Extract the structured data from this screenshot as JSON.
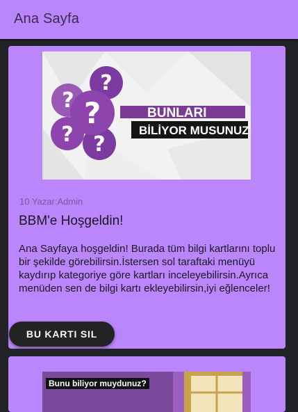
{
  "appbar": {
    "title": "Ana Sayfa"
  },
  "card1": {
    "image": {
      "line1": "BUNLARI",
      "line2": "BİLİYOR MUSUNUZ?",
      "icon": "question-marks-icon"
    },
    "meta": "10 Yazar:Admin",
    "title": "BBM'e Hoşgeldin!",
    "body": "Ana Sayfaya hoşgeldin! Burada tüm bilgi kartlarını toplu bir şekilde görebilirsin.İstersen sol taraftaki menüyü kaydırıp kategoriye göre kartları inceleyebilirsin.Ayrıca menüden sen de bilgi kartı ekleyebilirsin,iyi eğlenceler!",
    "delete_label": "BU KARTI SIL"
  },
  "card2": {
    "image": {
      "banner": "Bunu biliyor muydunuz?"
    }
  },
  "colors": {
    "primary": "#bb86fc",
    "background": "#222327",
    "button": "#232323"
  }
}
